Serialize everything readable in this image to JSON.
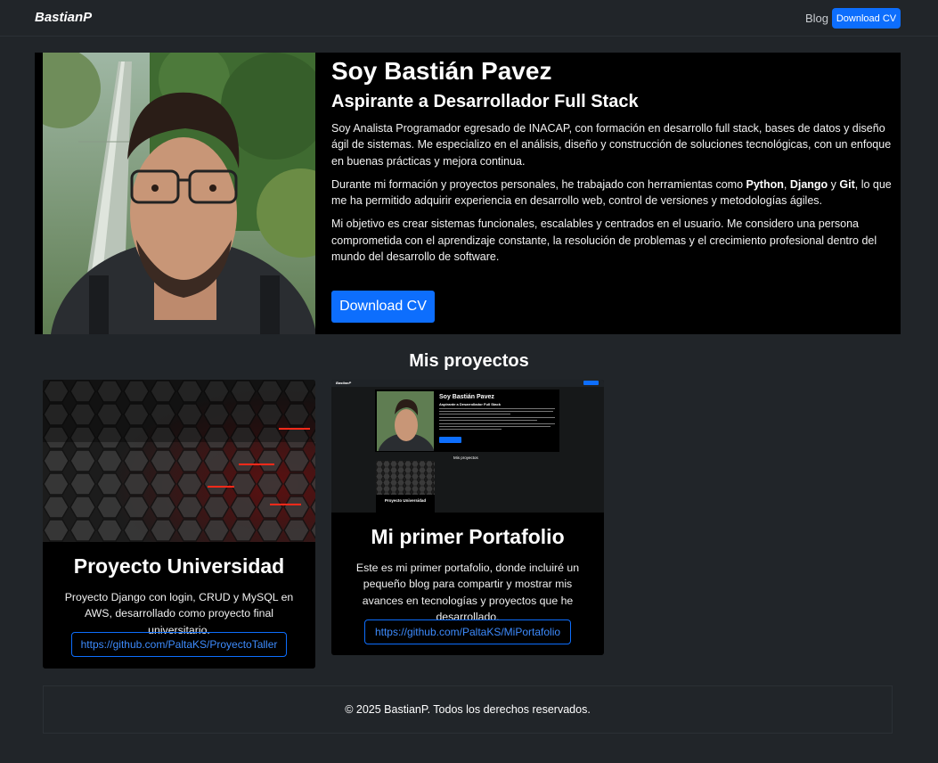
{
  "navbar": {
    "brand": "BastianP",
    "blog_label": "Blog",
    "download_label": "Download CV"
  },
  "hero": {
    "title": "Soy Bastián Pavez",
    "subtitle": "Aspirante a Desarrollador Full Stack",
    "p1": "Soy Analista Programador egresado de INACAP, con formación en desarrollo full stack, bases de datos y diseño ágil de sistemas.  Me especializo en el análisis, diseño y construcción de soluciones tecnológicas, con un enfoque en buenas prácticas y mejora continua.",
    "p2_before": "Durante mi formación y proyectos personales, he trabajado con herramientas como ",
    "p2_python": "Python",
    "p2_sep1": ", ",
    "p2_django": "Django",
    "p2_sep2": " y ",
    "p2_git": "Git",
    "p2_after": ", lo que me ha permitido adquirir experiencia en desarrollo web, control de versiones y metodologías ágiles.",
    "p3": "Mi objetivo es crear sistemas funcionales, escalables y centrados en el usuario.  Me considero una persona comprometida con el aprendizaje constante, la resolución de problemas y el crecimiento profesional dentro del mundo del desarrollo de software.",
    "button_label": "Download CV"
  },
  "projects": {
    "title": "Mis proyectos",
    "items": [
      {
        "title": "Proyecto Universidad",
        "description": "Proyecto Django con login, CRUD y MySQL en AWS, desarrollado como proyecto final universitario.",
        "link": "https://github.com/PaltaKS/ProyectoTaller"
      },
      {
        "title": "Mi primer Portafolio",
        "description": "Este es mi primer portafolio, donde incluiré un pequeño blog para compartir y mostrar mis avances en tecnologías y proyectos que he desarrollado.",
        "link": "https://github.com/PaltaKS/MiPortafolio"
      }
    ]
  },
  "mini_preview": {
    "brand": "BastianP",
    "title": "Soy Bastián Pavez",
    "subtitle": "Aspirante a Desarrollador Full Stack",
    "projects_title": "Mis proyectos",
    "card_title": "Proyecto Universidad"
  },
  "footer": {
    "text": "© 2025 BastianP. Todos los derechos reservados."
  },
  "colors": {
    "primary": "#0d6efd",
    "navbar_bg": "#212529",
    "card_bg": "#000000"
  }
}
